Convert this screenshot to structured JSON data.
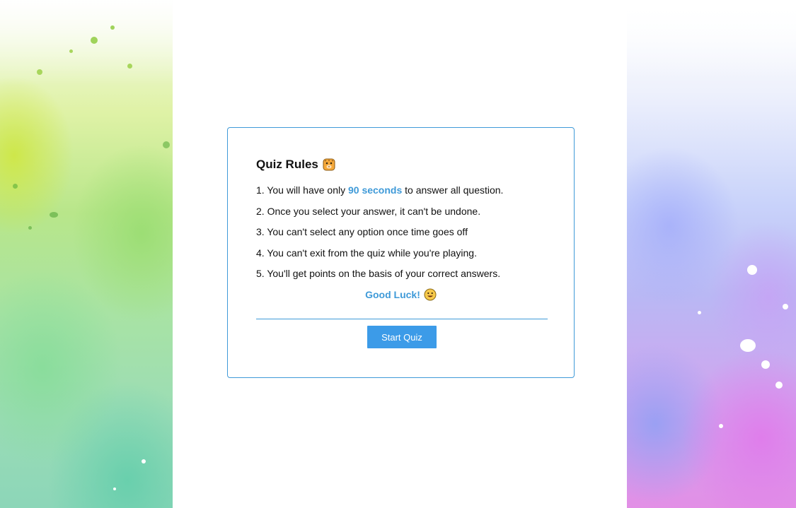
{
  "card": {
    "title": "Quiz Rules",
    "title_icon": "tiger-face-emoji-icon",
    "rules": {
      "r1_prefix": "1. You will have only ",
      "r1_highlight": "90 seconds",
      "r1_suffix": " to answer all question.",
      "r2": "2. Once you select your answer, it can't be undone.",
      "r3": "3. You can't select any option once time goes off",
      "r4": "4. You can't exit from the quiz while you're playing.",
      "r5": "5. You'll get points on the basis of your correct answers."
    },
    "good_luck": "Good Luck!",
    "good_luck_icon": "grinning-face-emoji-icon",
    "start_button": "Start Quiz"
  },
  "colors": {
    "accent": "#3f9ad8",
    "button": "#3c9be8",
    "text": "#111111"
  },
  "background": {
    "left_panel": "green-yellow-watercolor",
    "right_panel": "blue-purple-watercolor"
  }
}
